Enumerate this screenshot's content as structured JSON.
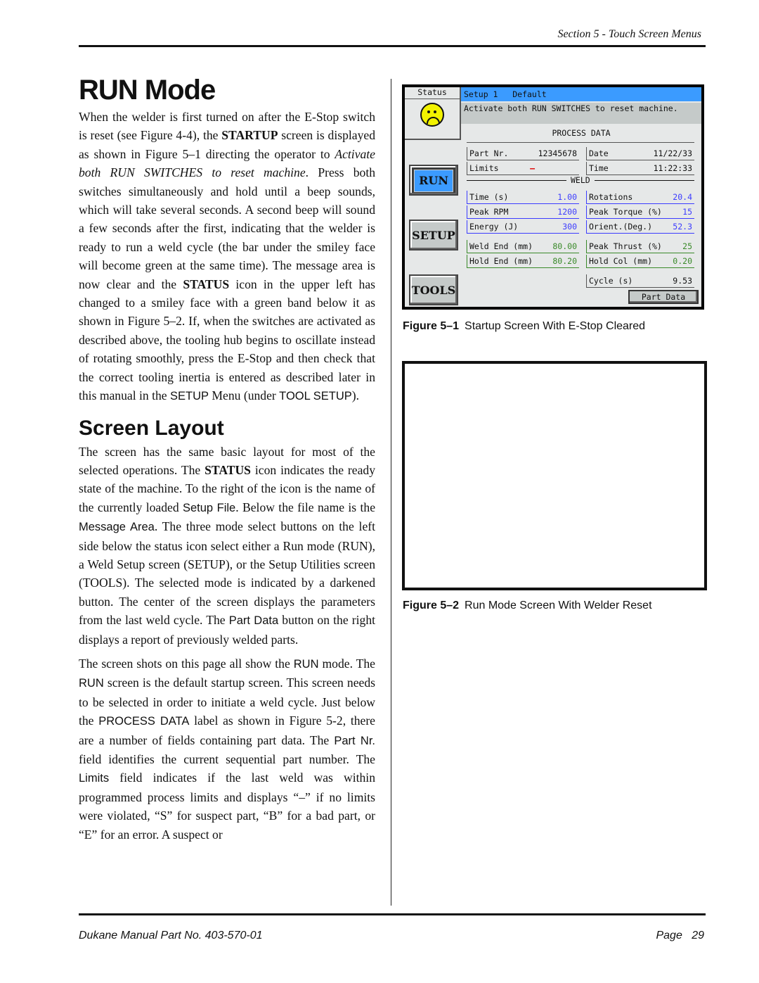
{
  "header": {
    "section": "Section 5 - Touch Screen Menus"
  },
  "title": "RUN Mode",
  "para1": {
    "a": "When the welder is first turned on after the E-Stop switch is reset (see Figure 4-4), the ",
    "b_bold": "STARTUP",
    "c": " screen is displayed as shown in Figure 5–1 directing the operator to ",
    "d_italic": "Activate both RUN SWITCHES to reset machine",
    "e": ". Press both switches simultaneously and hold until a beep sounds, which will take several seconds. A second beep will sound a few seconds after the first, indicating that the welder is ready to run a weld cycle (the bar under the smiley face will become green at the same time). The message area is now clear and the ",
    "f_bold": "STATUS",
    "g": " icon in the upper left has changed to a smiley face with a green band below it as shown in Figure 5–2. If, when the switches are activated as described above, the tooling hub begins to oscillate instead of rotating smoothly, press the E-Stop and then check that the correct tooling inertia is entered as described later in this manual in the ",
    "h_sans": "SETUP",
    "i": " Menu (under ",
    "j_sans": "TOOL SETUP",
    "k": ")."
  },
  "subtitle": "Screen Layout",
  "para2": {
    "a": "The screen has the same basic layout  for most of the selected operations. The ",
    "b_bold": "STATUS",
    "c": " icon indicates the ready state of the machine. To the right of the icon is the name of the currently loaded ",
    "d_sans": "Setup File",
    "e": ". Below the file name is the ",
    "f_sans": "Message Area",
    "g": ". The three mode select buttons on the left side below the status icon select either a Run mode (RUN), a Weld Setup screen (SETUP), or the Setup Utilities screen (TOOLS). The selected mode is indicated by a darkened button. The center of the screen displays the parameters from the last weld cycle. The ",
    "h_sans": "Part Data",
    "i": " button on the right displays a report of previously welded parts."
  },
  "para3": {
    "a": "The screen shots on this page all show the ",
    "b_sans": "RUN",
    "c": " mode. The ",
    "d_sans": "RUN",
    "e": " screen is the default startup screen. This screen needs to be selected in order to initiate a weld cycle. Just below the ",
    "f_sans": "PROCESS DATA",
    "g": " label as shown in Figure 5-2, there are a number of fields containing part data. The ",
    "h_sans": "Part Nr.",
    "i": " field identifies the current sequential part number. The ",
    "j_sans": "Limits",
    "k": " field indicates if the last weld was within programmed process limits and displays “–” if no limits were violated, “S” for suspect part, “B” for a bad part, or “E” for an error. A suspect or"
  },
  "screen": {
    "status_label": "Status",
    "status_icon": "frown-face-icon",
    "setup_name": "Setup 1   Default",
    "message": "Activate both RUN SWITCHES to reset machine.",
    "process_data_label": "PROCESS DATA",
    "weld_label": "WELD",
    "buttons": {
      "run": "RUN",
      "setup": "SETUP",
      "tools": "TOOLS",
      "part_data": "Part Data"
    },
    "fields": {
      "part_nr": {
        "label": "Part Nr.",
        "value": "12345678"
      },
      "date": {
        "label": "Date",
        "value": "11/22/33"
      },
      "limits": {
        "label": "Limits",
        "value": "–"
      },
      "time_clock": {
        "label": "Time",
        "value": "11:22:33"
      },
      "time_s": {
        "label": "Time (s)",
        "value": "1.00"
      },
      "rotations": {
        "label": "Rotations",
        "value": "20.4"
      },
      "peak_rpm": {
        "label": "Peak RPM",
        "value": "1200"
      },
      "peak_torque": {
        "label": "Peak Torque (%)",
        "value": "15"
      },
      "energy": {
        "label": "Energy (J)",
        "value": "300"
      },
      "orient": {
        "label": "Orient.(Deg.)",
        "value": "52.3"
      },
      "weld_end": {
        "label": "Weld End (mm)",
        "value": "80.00"
      },
      "peak_thrust": {
        "label": "Peak Thrust (%)",
        "value": "25"
      },
      "hold_end": {
        "label": "Hold End (mm)",
        "value": "80.20"
      },
      "hold_col": {
        "label": "Hold Col (mm)",
        "value": "0.20"
      },
      "cycle": {
        "label": "Cycle (s)",
        "value": "9.53"
      }
    },
    "colors": {
      "setup_bar": "#3b9bff",
      "blue_values": "#3c3cff",
      "green_values": "#3a8a2a",
      "limits": "#e00000"
    }
  },
  "figures": [
    {
      "number": "Figure 5–1",
      "caption": "Startup Screen With E-Stop Cleared"
    },
    {
      "number": "Figure 5–2",
      "caption": "Run Mode Screen With Welder Reset"
    }
  ],
  "footer": {
    "manual": "Dukane Manual Part No. 403-570-01",
    "page_label": "Page",
    "page_number": "29"
  }
}
